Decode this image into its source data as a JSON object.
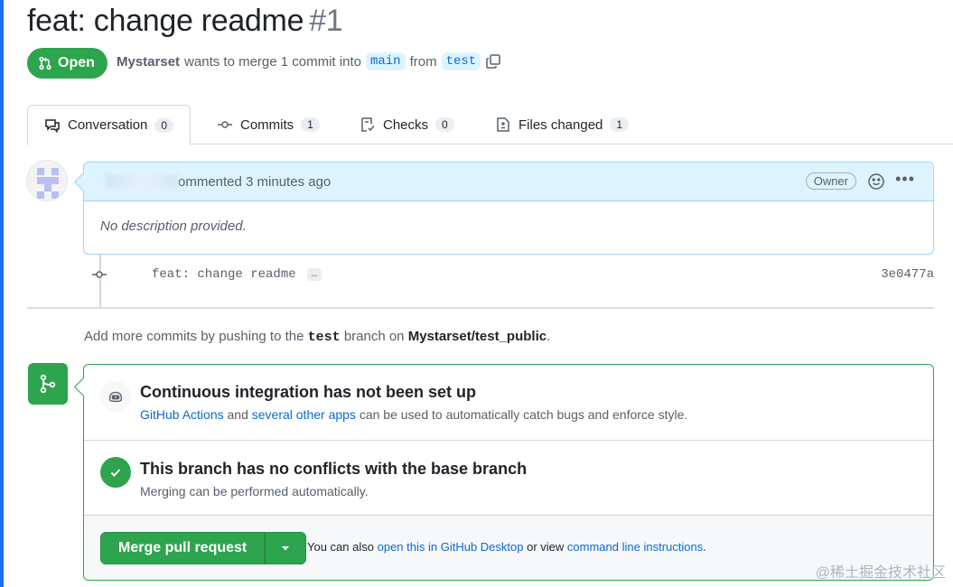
{
  "pr": {
    "title": "feat: change readme",
    "number": "#1",
    "state": "Open",
    "author": "Mystarset",
    "merge_text": "wants to merge 1 commit into",
    "base_branch": "main",
    "from_text": "from",
    "head_branch": "test"
  },
  "tabs": [
    {
      "label": "Conversation",
      "count": "0",
      "icon": "comment-icon"
    },
    {
      "label": "Commits",
      "count": "1",
      "icon": "commit-icon"
    },
    {
      "label": "Checks",
      "count": "0",
      "icon": "checklist-icon"
    },
    {
      "label": "Files changed",
      "count": "1",
      "icon": "file-diff-icon"
    }
  ],
  "comment": {
    "header_text": "ommented 3 minutes ago",
    "owner_badge": "Owner",
    "body": "No description provided."
  },
  "commit": {
    "message": "feat: change readme",
    "ellipsis": "…",
    "sha": "3e0477a"
  },
  "push_note": {
    "prefix": "Add more commits by pushing to the",
    "branch": "test",
    "middle": "branch on",
    "repo": "Mystarset/test_public",
    "suffix": "."
  },
  "ci": {
    "title": "Continuous integration has not been set up",
    "link1": "GitHub Actions",
    "mid1": "and",
    "link2": "several other apps",
    "rest": "can be used to automatically catch bugs and enforce style."
  },
  "conflicts": {
    "title": "This branch has no conflicts with the base branch",
    "sub": "Merging can be performed automatically."
  },
  "merge": {
    "button_label": "Merge pull request",
    "alt_prefix": "You can also",
    "alt_link1": "open this in GitHub Desktop",
    "alt_mid": "or view",
    "alt_link2": "command line instructions",
    "alt_suffix": "."
  },
  "watermark": "@稀土掘金技术社区",
  "colors": {
    "accent_green": "#2da44e",
    "link_blue": "#0969da",
    "comment_header_bg": "#ddf4ff"
  }
}
